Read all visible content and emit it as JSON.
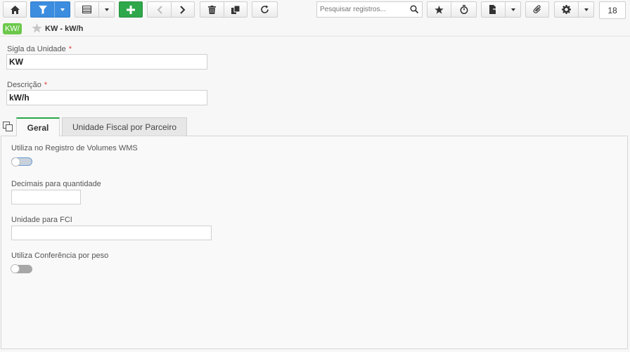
{
  "toolbar": {
    "search_placeholder": "Pesquisar registros...",
    "record_count": "18",
    "icons": [
      "home-icon",
      "filter-icon",
      "list-view-icon",
      "add-icon",
      "arrow-left-icon",
      "arrow-right-icon",
      "trash-icon",
      "copy-icon",
      "refresh-icon",
      "search-icon",
      "star-icon",
      "timer-icon",
      "export-icon",
      "paperclip-icon",
      "gear-icon"
    ],
    "colors": {
      "filter": "#3c8de0",
      "add": "#2ea84a"
    }
  },
  "breadcrumb": {
    "badge": "KW/",
    "title": "KW - kW/h",
    "badge_color": "#6cc84a"
  },
  "form": {
    "sigla_label": "Sigla da Unidade",
    "sigla_value": "KW",
    "descricao_label": "Descrição",
    "descricao_value": "kW/h",
    "required_mark": "*"
  },
  "tabs": [
    {
      "label": "Geral",
      "active": true
    },
    {
      "label": "Unidade Fiscal por Parceiro",
      "active": false
    }
  ],
  "geral": {
    "wms_label": "Utiliza no Registro de Volumes WMS",
    "wms_enabled": false,
    "decimais_label": "Decimais para quantidade",
    "decimais_value": "",
    "fci_label": "Unidade para FCI",
    "fci_value": "",
    "peso_label": "Utiliza Conferência por peso",
    "peso_enabled": false
  }
}
